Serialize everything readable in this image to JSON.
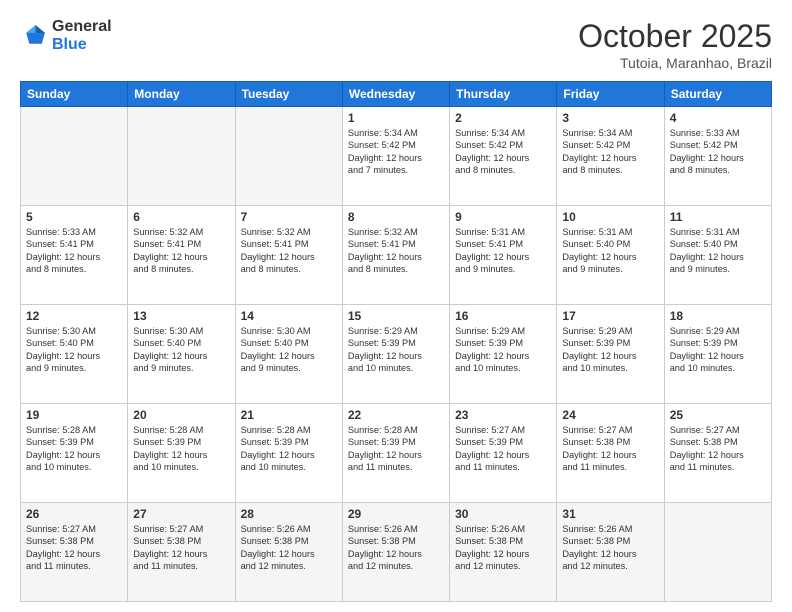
{
  "header": {
    "logo": {
      "line1": "General",
      "line2": "Blue"
    },
    "title": "October 2025",
    "location": "Tutoia, Maranhao, Brazil"
  },
  "weekdays": [
    "Sunday",
    "Monday",
    "Tuesday",
    "Wednesday",
    "Thursday",
    "Friday",
    "Saturday"
  ],
  "rows": [
    [
      {
        "day": "",
        "text": ""
      },
      {
        "day": "",
        "text": ""
      },
      {
        "day": "",
        "text": ""
      },
      {
        "day": "1",
        "text": "Sunrise: 5:34 AM\nSunset: 5:42 PM\nDaylight: 12 hours\nand 7 minutes."
      },
      {
        "day": "2",
        "text": "Sunrise: 5:34 AM\nSunset: 5:42 PM\nDaylight: 12 hours\nand 8 minutes."
      },
      {
        "day": "3",
        "text": "Sunrise: 5:34 AM\nSunset: 5:42 PM\nDaylight: 12 hours\nand 8 minutes."
      },
      {
        "day": "4",
        "text": "Sunrise: 5:33 AM\nSunset: 5:42 PM\nDaylight: 12 hours\nand 8 minutes."
      }
    ],
    [
      {
        "day": "5",
        "text": "Sunrise: 5:33 AM\nSunset: 5:41 PM\nDaylight: 12 hours\nand 8 minutes."
      },
      {
        "day": "6",
        "text": "Sunrise: 5:32 AM\nSunset: 5:41 PM\nDaylight: 12 hours\nand 8 minutes."
      },
      {
        "day": "7",
        "text": "Sunrise: 5:32 AM\nSunset: 5:41 PM\nDaylight: 12 hours\nand 8 minutes."
      },
      {
        "day": "8",
        "text": "Sunrise: 5:32 AM\nSunset: 5:41 PM\nDaylight: 12 hours\nand 8 minutes."
      },
      {
        "day": "9",
        "text": "Sunrise: 5:31 AM\nSunset: 5:41 PM\nDaylight: 12 hours\nand 9 minutes."
      },
      {
        "day": "10",
        "text": "Sunrise: 5:31 AM\nSunset: 5:40 PM\nDaylight: 12 hours\nand 9 minutes."
      },
      {
        "day": "11",
        "text": "Sunrise: 5:31 AM\nSunset: 5:40 PM\nDaylight: 12 hours\nand 9 minutes."
      }
    ],
    [
      {
        "day": "12",
        "text": "Sunrise: 5:30 AM\nSunset: 5:40 PM\nDaylight: 12 hours\nand 9 minutes."
      },
      {
        "day": "13",
        "text": "Sunrise: 5:30 AM\nSunset: 5:40 PM\nDaylight: 12 hours\nand 9 minutes."
      },
      {
        "day": "14",
        "text": "Sunrise: 5:30 AM\nSunset: 5:40 PM\nDaylight: 12 hours\nand 9 minutes."
      },
      {
        "day": "15",
        "text": "Sunrise: 5:29 AM\nSunset: 5:39 PM\nDaylight: 12 hours\nand 10 minutes."
      },
      {
        "day": "16",
        "text": "Sunrise: 5:29 AM\nSunset: 5:39 PM\nDaylight: 12 hours\nand 10 minutes."
      },
      {
        "day": "17",
        "text": "Sunrise: 5:29 AM\nSunset: 5:39 PM\nDaylight: 12 hours\nand 10 minutes."
      },
      {
        "day": "18",
        "text": "Sunrise: 5:29 AM\nSunset: 5:39 PM\nDaylight: 12 hours\nand 10 minutes."
      }
    ],
    [
      {
        "day": "19",
        "text": "Sunrise: 5:28 AM\nSunset: 5:39 PM\nDaylight: 12 hours\nand 10 minutes."
      },
      {
        "day": "20",
        "text": "Sunrise: 5:28 AM\nSunset: 5:39 PM\nDaylight: 12 hours\nand 10 minutes."
      },
      {
        "day": "21",
        "text": "Sunrise: 5:28 AM\nSunset: 5:39 PM\nDaylight: 12 hours\nand 10 minutes."
      },
      {
        "day": "22",
        "text": "Sunrise: 5:28 AM\nSunset: 5:39 PM\nDaylight: 12 hours\nand 11 minutes."
      },
      {
        "day": "23",
        "text": "Sunrise: 5:27 AM\nSunset: 5:39 PM\nDaylight: 12 hours\nand 11 minutes."
      },
      {
        "day": "24",
        "text": "Sunrise: 5:27 AM\nSunset: 5:38 PM\nDaylight: 12 hours\nand 11 minutes."
      },
      {
        "day": "25",
        "text": "Sunrise: 5:27 AM\nSunset: 5:38 PM\nDaylight: 12 hours\nand 11 minutes."
      }
    ],
    [
      {
        "day": "26",
        "text": "Sunrise: 5:27 AM\nSunset: 5:38 PM\nDaylight: 12 hours\nand 11 minutes."
      },
      {
        "day": "27",
        "text": "Sunrise: 5:27 AM\nSunset: 5:38 PM\nDaylight: 12 hours\nand 11 minutes."
      },
      {
        "day": "28",
        "text": "Sunrise: 5:26 AM\nSunset: 5:38 PM\nDaylight: 12 hours\nand 12 minutes."
      },
      {
        "day": "29",
        "text": "Sunrise: 5:26 AM\nSunset: 5:38 PM\nDaylight: 12 hours\nand 12 minutes."
      },
      {
        "day": "30",
        "text": "Sunrise: 5:26 AM\nSunset: 5:38 PM\nDaylight: 12 hours\nand 12 minutes."
      },
      {
        "day": "31",
        "text": "Sunrise: 5:26 AM\nSunset: 5:38 PM\nDaylight: 12 hours\nand 12 minutes."
      },
      {
        "day": "",
        "text": ""
      }
    ]
  ]
}
